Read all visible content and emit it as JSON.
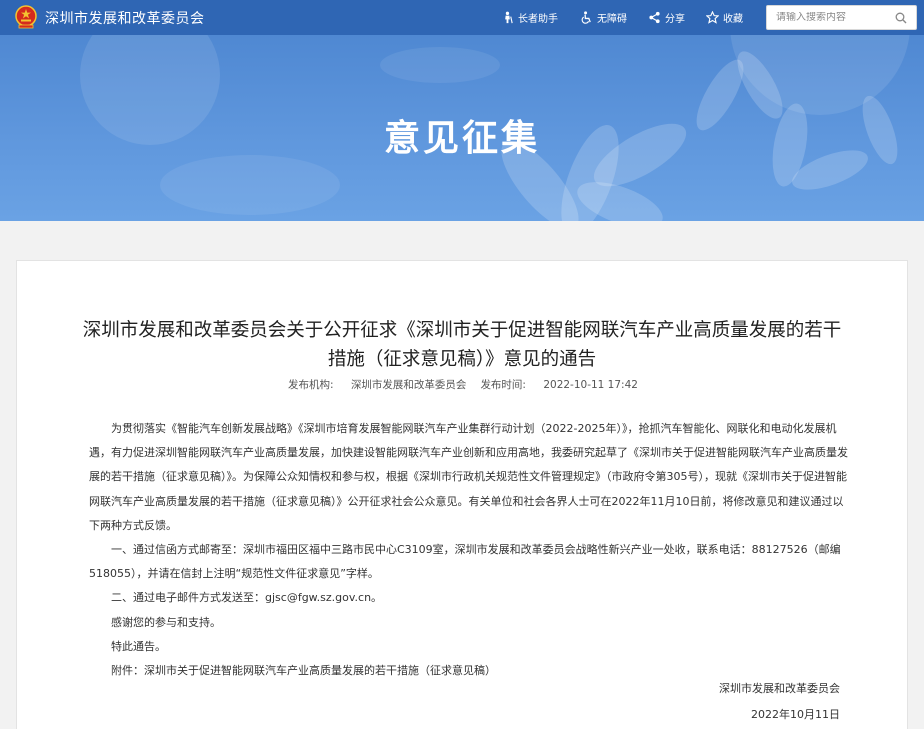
{
  "header": {
    "site_title": "深圳市发展和改革委员会",
    "tools": [
      {
        "label": "长者助手",
        "icon": "elder-assistant-icon"
      },
      {
        "label": "无障碍",
        "icon": "accessibility-icon"
      },
      {
        "label": "分享",
        "icon": "share-icon"
      },
      {
        "label": "收藏",
        "icon": "star-icon"
      }
    ],
    "search_placeholder": "请输入搜索内容"
  },
  "banner": {
    "title": "意见征集"
  },
  "article": {
    "title": "深圳市发展和改革委员会关于公开征求《深圳市关于促进智能网联汽车产业高质量发展的若干措施（征求意见稿）》意见的通告",
    "publisher_label": "发布机构:",
    "publisher": "深圳市发展和改革委员会",
    "time_label": "发布时间:",
    "time": "2022-10-11 17:42",
    "paragraphs": [
      "为贯彻落实《智能汽车创新发展战略》《深圳市培育发展智能网联汽车产业集群行动计划（2022-2025年）》，抢抓汽车智能化、网联化和电动化发展机遇，有力促进深圳智能网联汽车产业高质量发展，加快建设智能网联汽车产业创新和应用高地，我委研究起草了《深圳市关于促进智能网联汽车产业高质量发展的若干措施（征求意见稿）》。为保障公众知情权和参与权，根据《深圳市行政机关规范性文件管理规定》（市政府令第305号），现就《深圳市关于促进智能网联汽车产业高质量发展的若干措施（征求意见稿）》公开征求社会公众意见。有关单位和社会各界人士可在2022年11月10日前，将修改意见和建议通过以下两种方式反馈。",
      "一、通过信函方式邮寄至：深圳市福田区福中三路市民中心C3109室，深圳市发展和改革委员会战略性新兴产业一处收，联系电话：88127526（邮编518055），并请在信封上注明“规范性文件征求意见”字样。",
      "二、通过电子邮件方式发送至：gjsc@fgw.sz.gov.cn。",
      "感谢您的参与和支持。",
      "特此通告。",
      "附件：深圳市关于促进智能网联汽车产业高质量发展的若干措施（征求意见稿）"
    ],
    "signature": "深圳市发展和改革委员会",
    "date": "2022年10月11日"
  },
  "colors": {
    "topbar": "#2f66b4",
    "banner": "#5f97dd",
    "page_bg": "#f2f2f2",
    "emblem_red": "#d42b1e",
    "emblem_gold": "#f4c430"
  }
}
